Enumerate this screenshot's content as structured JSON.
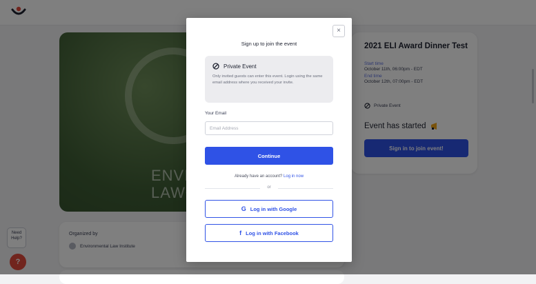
{
  "page": {
    "hero_text_line1": "ENVIR",
    "hero_text_line2": "LAW•"
  },
  "event_card": {
    "title": "2021 ELI Award Dinner Test",
    "start_label": "Start time",
    "start_value": "October 11th, 06:00pm - EDT",
    "end_label": "End time",
    "end_value": "October 12th, 07:00pm - EDT",
    "private_label": "Private Event",
    "status": "Event has started",
    "signin_button": "Sign in to join event!"
  },
  "organizer": {
    "label": "Organized by",
    "name": "Environmental Law Institute"
  },
  "help": {
    "bubble": "Need Help?"
  },
  "modal": {
    "close": "×",
    "title": "Sign up to join the event",
    "notice_title": "Private Event",
    "notice_body": "Only invited guests can enter this event. Login using the same email address where you received your invite.",
    "email_label": "Your Email",
    "email_placeholder": "Email Address",
    "email_value": "",
    "continue_button": "Continue",
    "account_prompt": "Already have an account?",
    "login_link": "Log in now",
    "or": "or",
    "google_button": "Log in with Google",
    "facebook_button": "Log in with Facebook"
  },
  "colors": {
    "accent": "#2f52e6",
    "help": "#e24b3c"
  },
  "icons": {
    "brand": "logo-icon",
    "private": "no-eye-icon",
    "started": "megaphone-icon",
    "google": "google-icon",
    "facebook": "facebook-icon"
  }
}
